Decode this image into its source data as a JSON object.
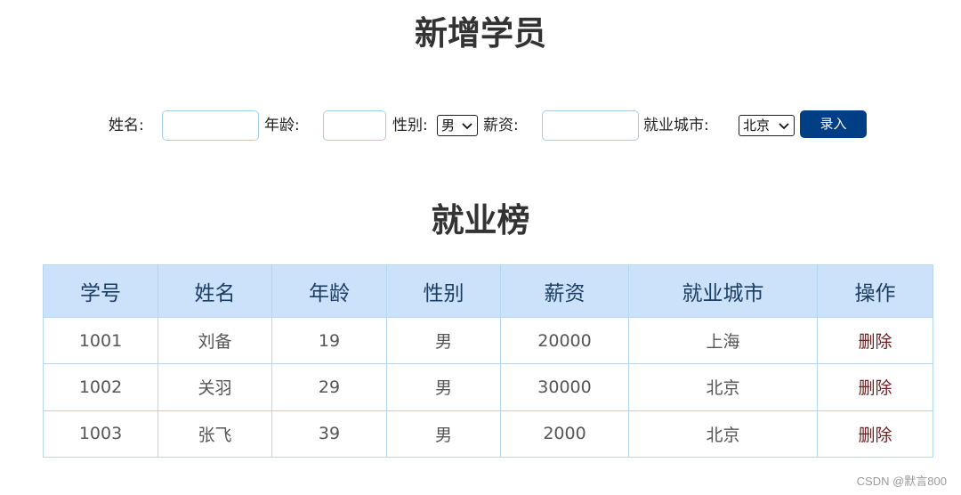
{
  "form": {
    "title": "新增学员",
    "name_label": "姓名:",
    "name_value": "",
    "age_label": "年龄:",
    "age_value": "",
    "gender_label": "性别:",
    "gender_selected": "男",
    "salary_label": "薪资:",
    "salary_value": "",
    "city_label": "就业城市:",
    "city_selected": "北京",
    "submit_label": "录入"
  },
  "board": {
    "title": "就业榜",
    "columns": [
      "学号",
      "姓名",
      "年龄",
      "性别",
      "薪资",
      "就业城市",
      "操作"
    ],
    "rows": [
      [
        "1001",
        "刘备",
        "19",
        "男",
        "20000",
        "上海",
        "删除"
      ],
      [
        "1002",
        "关羽",
        "29",
        "男",
        "30000",
        "北京",
        "删除"
      ],
      [
        "1003",
        "张飞",
        "39",
        "男",
        "2000",
        "北京",
        "删除"
      ]
    ]
  },
  "watermark": "CSDN @默言800",
  "colors": {
    "button_bg": "#003f86",
    "header_bg": "#cce2fb",
    "border": "#b5d6ef",
    "delete_text": "#6b2020"
  }
}
